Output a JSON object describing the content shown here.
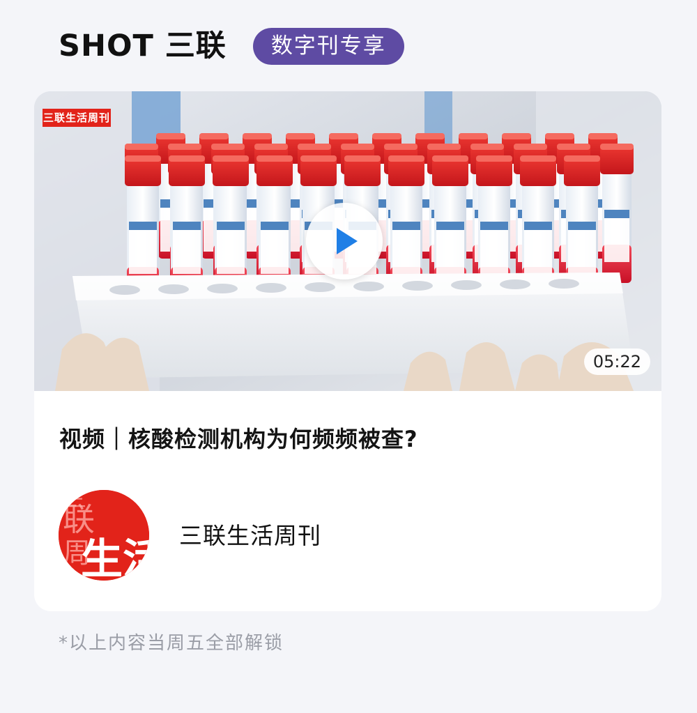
{
  "header": {
    "title": "SHOT 三联",
    "badge": "数字刊专享"
  },
  "video_card": {
    "thumbnail_logo": "三联生活周刊",
    "duration": "05:22",
    "title": "视频｜核酸检测机构为何频频被查?",
    "author": {
      "name": "三联生活周刊",
      "avatar_text": "三联生活周刊"
    }
  },
  "footer": {
    "note": "*以上内容当周五全部解锁"
  },
  "colors": {
    "background": "#f4f5f9",
    "badge": "#5e4ba3",
    "play_icon": "#1f7fe6",
    "brand_red": "#e2231a"
  }
}
